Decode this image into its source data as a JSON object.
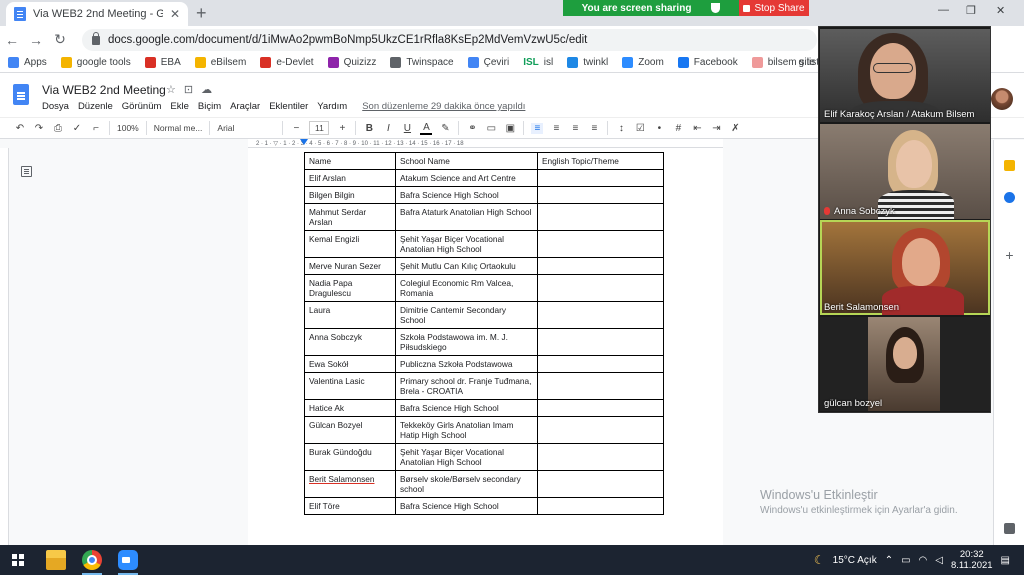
{
  "browser": {
    "tab_title": "Via WEB2 2nd Meeting - Google Do",
    "tab_close": "✕",
    "new_tab": "+",
    "url": "docs.google.com/document/d/1iMwAo2pwmBoNmp5UkzCE1rRfla8KsEp2MdVemVzwU5c/edit",
    "screen_sharing": "You are screen sharing",
    "stop_share": "Stop Share",
    "window_controls": [
      "—",
      "❐",
      "✕"
    ]
  },
  "bookmarks": {
    "items": [
      {
        "label": "Apps",
        "color": "#4285f4"
      },
      {
        "label": "google tools",
        "color": "#f4b400"
      },
      {
        "label": "EBA",
        "color": "#d93025"
      },
      {
        "label": "eBilsem",
        "color": "#f4b400"
      },
      {
        "label": "e-Devlet",
        "color": "#d93025"
      },
      {
        "label": "Quizizz",
        "color": "#8e24aa"
      },
      {
        "label": "Twinspace",
        "color": "#5f6368"
      },
      {
        "label": "Çeviri",
        "color": "#4285f4"
      },
      {
        "label": "isl",
        "color": "#0f9d58"
      },
      {
        "label": "twinkl",
        "color": "#1e88e5"
      },
      {
        "label": "Zoom",
        "color": "#2d8cff"
      },
      {
        "label": "Facebook",
        "color": "#1877f2"
      },
      {
        "label": "bilsem site",
        "color": "#ef9a9a"
      }
    ],
    "overflow_label": "g list",
    "isl_prefix": "ISL"
  },
  "docs": {
    "title": "Via WEB2 2nd Meeting",
    "title_icons": [
      "☆",
      "⊡",
      "☁"
    ],
    "menu": [
      "Dosya",
      "Düzenle",
      "Görünüm",
      "Ekle",
      "Biçim",
      "Araçlar",
      "Eklentiler",
      "Yardım"
    ],
    "last_edit": "Son düzenleme 29 dakika önce yapıldı"
  },
  "toolbar": {
    "zoom": "100%",
    "style": "Normal me...",
    "font": "Arial",
    "size": "11",
    "bold": "B",
    "italic": "I",
    "underline": "U",
    "text_color": "A",
    "minus": "−",
    "plus": "+"
  },
  "ruler": {
    "ticks": "2 · 1 · ▽ · 1 · 2 · 3 · 4 · 5 · 6 · 7 · 8 · 9 · 10 · 11 · 12 · 13 · 14 · 15 · 16 · 17 · 18"
  },
  "table": {
    "headers": [
      "Name",
      "School Name",
      "English Topic/Theme"
    ],
    "rows": [
      {
        "name": "Elif Arslan",
        "school": "Atakum Science and Art Centre",
        "topic": ""
      },
      {
        "name": "Bilgen Bilgin",
        "school": "Bafra Science High School",
        "topic": ""
      },
      {
        "name": "Mahmut Serdar Arslan",
        "school": "Bafra Ataturk Anatolian High School",
        "topic": ""
      },
      {
        "name": "Kemal Engizli",
        "school": "Şehit Yaşar Biçer Vocational Anatolian High School",
        "topic": ""
      },
      {
        "name": "Merve Nuran Sezer",
        "school": "Şehit Mutlu Can Kılıç Ortaokulu",
        "topic": ""
      },
      {
        "name": "Nadia Papa Dragulescu",
        "school": "Colegiul Economic Rm Valcea, Romania",
        "topic": ""
      },
      {
        "name": "Laura",
        "school": "Dimitrie Cantemir Secondary School",
        "topic": ""
      },
      {
        "name": "Anna Sobczyk",
        "school": "Szkoła Podstawowa im. M. J. Piłsudskiego",
        "topic": ""
      },
      {
        "name": "Ewa Sokół",
        "school": "Publiczna Szkoła Podstawowa",
        "topic": ""
      },
      {
        "name": "Valentina Lasic",
        "school": "Primary school dr. Franje Tuđmana, Brela - CROATIA",
        "topic": ""
      },
      {
        "name": "Hatice Ak",
        "school": "Bafra Science High School",
        "topic": ""
      },
      {
        "name": "Gülcan Bozyel",
        "school": "Tekkeköy Girls Anatolian Imam Hatip High School",
        "topic": ""
      },
      {
        "name": "Burak Gündoğdu",
        "school": "Şehit Yaşar Biçer Vocational Anatolian High School",
        "topic": ""
      },
      {
        "name": "Berit Salamonsen",
        "school": "Børselv skole/Børselv secondary school",
        "topic": ""
      },
      {
        "name": "Elif Töre",
        "school": "Bafra Science High School",
        "topic": ""
      }
    ]
  },
  "zoom_meeting": {
    "participants": [
      {
        "name": "Elif Karakoç Arslan / Atakum Bilsem",
        "muted": false,
        "active": false
      },
      {
        "name": "Anna Sobczyk",
        "muted": true,
        "active": false
      },
      {
        "name": "Berit Salamonsen",
        "muted": false,
        "active": true
      },
      {
        "name": "gülcan bozyel",
        "muted": false,
        "active": false
      }
    ]
  },
  "watermark": {
    "title": "Windows'u Etkinleştir",
    "subtitle": "Windows'u etkinleştirmek için Ayarlar'a gidin."
  },
  "taskbar": {
    "weather": "15°C  Açık",
    "time": "20:32",
    "date": "8.11.2021"
  }
}
